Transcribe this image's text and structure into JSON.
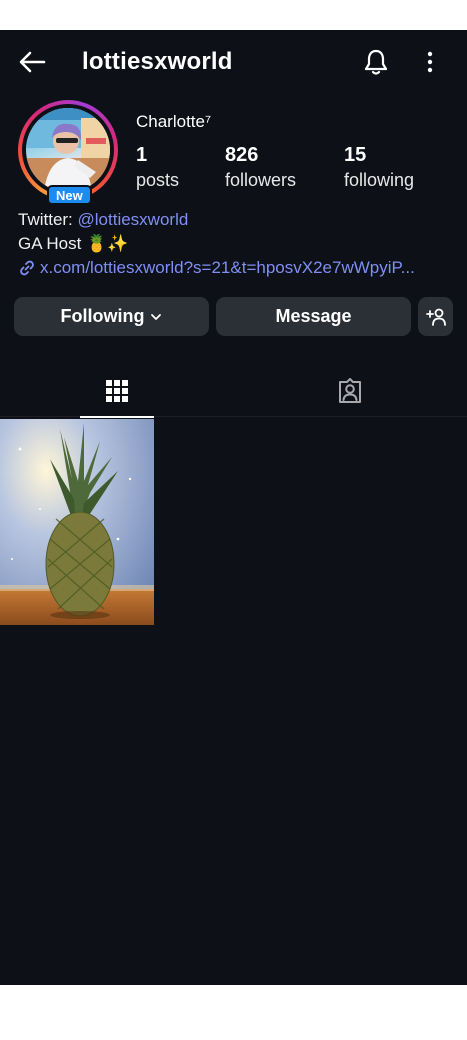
{
  "header": {
    "username": "lottiesxworld"
  },
  "profile": {
    "display_name": "Charlotte⁷",
    "badge": "New",
    "stats": [
      {
        "value": "1",
        "label": "posts"
      },
      {
        "value": "826",
        "label": "followers"
      },
      {
        "value": "15",
        "label": "following"
      }
    ],
    "bio": {
      "twitter_prefix": "Twitter: ",
      "twitter_handle": "@lottiesxworld",
      "line2": "GA Host 🍍✨",
      "link": "x.com/lottiesxworld?s=21&t=hposvX2e7wWpyiP..."
    }
  },
  "actions": {
    "following_label": "Following",
    "message_label": "Message"
  },
  "icons": [
    "back-arrow-icon",
    "bell-icon",
    "more-vertical-icon",
    "link-icon",
    "chevron-down-icon",
    "add-person-icon",
    "grid-icon",
    "tagged-person-icon"
  ],
  "colors": {
    "background": "#0d1017",
    "button": "#2b2f36",
    "link": "#7f8ff4",
    "badge": "#1d8cf0"
  }
}
